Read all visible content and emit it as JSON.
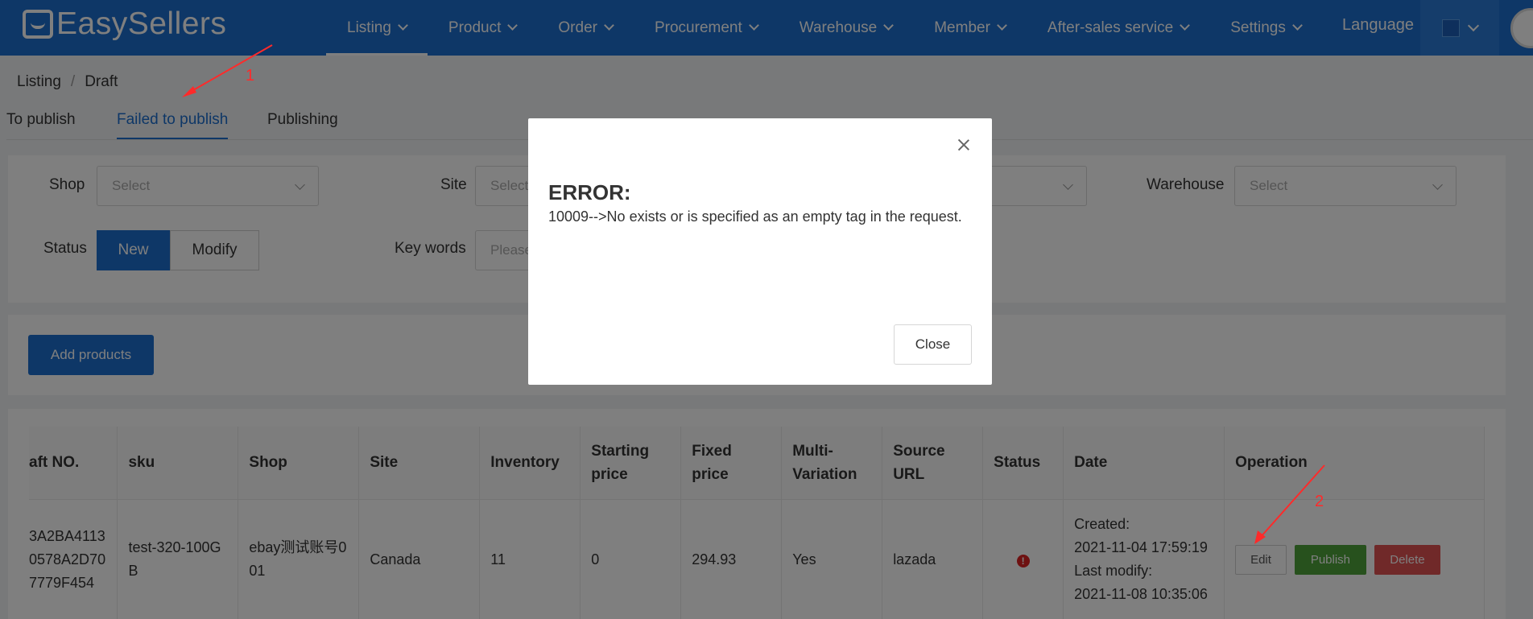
{
  "app": {
    "logo_text": "EasySellers"
  },
  "nav": {
    "items": [
      {
        "label": "Listing",
        "active": true
      },
      {
        "label": "Product"
      },
      {
        "label": "Order"
      },
      {
        "label": "Procurement"
      },
      {
        "label": "Warehouse"
      },
      {
        "label": "Member"
      },
      {
        "label": "After-sales service"
      },
      {
        "label": "Settings"
      }
    ],
    "language_label": "Language"
  },
  "breadcrumb": {
    "root": "Listing",
    "separator": "/",
    "current": "Draft"
  },
  "tabs": [
    {
      "label": "To publish"
    },
    {
      "label": "Failed to publish",
      "active": true
    },
    {
      "label": "Publishing"
    }
  ],
  "filters": {
    "shop_label": "Shop",
    "shop_placeholder": "Select",
    "site_label": "Site",
    "site_placeholder": "Select",
    "warehouse_label": "Warehouse",
    "warehouse_placeholder": "Select",
    "status_label": "Status",
    "status_new": "New",
    "status_modify": "Modify",
    "keywords_label": "Key words",
    "keywords_placeholder": "Please"
  },
  "actions": {
    "add_products": "Add products"
  },
  "table": {
    "headers": [
      "aft NO.",
      "sku",
      "Shop",
      "Site",
      "Inventory",
      "Starting price",
      "Fixed price",
      "Multi-Variation",
      "Source URL",
      "Status",
      "Date",
      "Operation"
    ],
    "rows": [
      {
        "draft_no": "3A2BA4113 0578A2D70 7779F454",
        "sku": "test-320-100GB",
        "shop": "ebay测试账号001",
        "site": "Canada",
        "inventory": "11",
        "starting_price": "0",
        "fixed_price": "294.93",
        "multi_variation": "Yes",
        "source_url": "lazada",
        "status_icon": "!",
        "created_label": "Created:",
        "created": "2021-11-04 17:59:19",
        "modified_label": "Last modify:",
        "modified": "2021-11-08 10:35:06",
        "op_edit": "Edit",
        "op_publish": "Publish",
        "op_delete": "Delete"
      }
    ]
  },
  "annotations": {
    "arrow1_label": "1",
    "arrow2_label": "2",
    "color": "#ff2a2a"
  },
  "modal": {
    "title": "ERROR:",
    "message": "10009-->No exists or is specified as an empty tag in the request.",
    "close_button": "Close"
  },
  "colors": {
    "brand": "#1d6fce",
    "success": "#4fa33a",
    "danger": "#e05252"
  }
}
